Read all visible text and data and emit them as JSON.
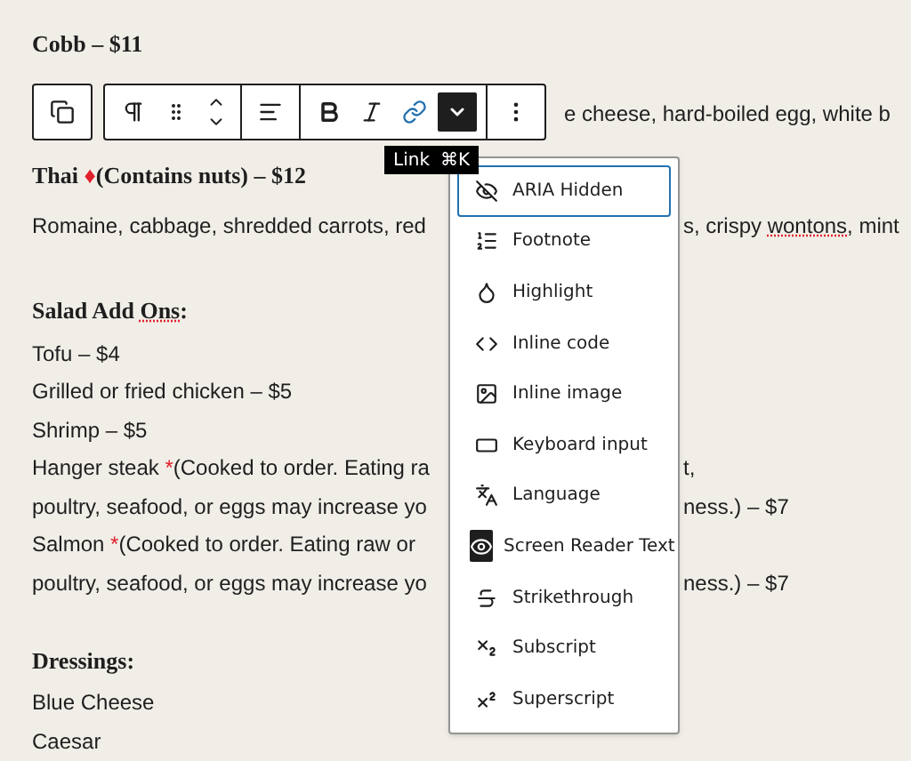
{
  "content": [
    {
      "kind": "heading",
      "left": [
        {
          "kind": "plain",
          "text": "Cobb – $11"
        }
      ]
    },
    {
      "kind": "toolbar_line",
      "right": [
        {
          "kind": "plain",
          "text": "e cheese, hard-boiled egg, white b"
        }
      ]
    },
    {
      "kind": "heading",
      "left": [
        {
          "kind": "plain",
          "text": "Thai "
        },
        {
          "kind": "mark",
          "text": "♦"
        },
        {
          "kind": "plain",
          "text": "(Contains nuts) – $12"
        }
      ]
    },
    {
      "kind": "line",
      "left": [
        {
          "kind": "plain",
          "text": "Romaine, cabbage, shredded carrots, red"
        }
      ],
      "right": [
        {
          "kind": "plain",
          "text": "s, crispy "
        },
        {
          "kind": "flagged",
          "text": "wontons"
        },
        {
          "kind": "plain",
          "text": ", mint"
        }
      ]
    },
    {
      "kind": "heading",
      "left": [
        {
          "kind": "plain",
          "text": "Salad Add "
        },
        {
          "kind": "flagged",
          "text": "Ons"
        },
        {
          "kind": "plain",
          "text": ":"
        }
      ]
    },
    {
      "kind": "item",
      "left": [
        {
          "kind": "plain",
          "text": "Tofu – $4"
        }
      ]
    },
    {
      "kind": "item",
      "left": [
        {
          "kind": "plain",
          "text": "Grilled or fried chicken – $5"
        }
      ]
    },
    {
      "kind": "item",
      "left": [
        {
          "kind": "plain",
          "text": "Shrimp – $5"
        }
      ]
    },
    {
      "kind": "item",
      "left": [
        {
          "kind": "plain",
          "text": "Hanger steak "
        },
        {
          "kind": "mark",
          "text": "*"
        },
        {
          "kind": "plain",
          "text": "(Cooked to order. Eating ra"
        }
      ],
      "right": [
        {
          "kind": "plain",
          "text": "t,"
        }
      ]
    },
    {
      "kind": "item",
      "left": [
        {
          "kind": "plain",
          "text": "poultry, seafood, or eggs may increase yo"
        }
      ],
      "right": [
        {
          "kind": "plain",
          "text": "ness.) – $7"
        }
      ]
    },
    {
      "kind": "item",
      "left": [
        {
          "kind": "plain",
          "text": "Salmon "
        },
        {
          "kind": "mark",
          "text": "*"
        },
        {
          "kind": "plain",
          "text": "(Cooked to order. Eating raw or"
        }
      ]
    },
    {
      "kind": "item",
      "left": [
        {
          "kind": "plain",
          "text": "poultry, seafood, or eggs may increase yo"
        }
      ],
      "right": [
        {
          "kind": "plain",
          "text": "ness.) – $7"
        }
      ]
    },
    {
      "kind": "heading",
      "left": [
        {
          "kind": "plain",
          "text": "Dressings:"
        }
      ]
    },
    {
      "kind": "item",
      "left": [
        {
          "kind": "plain",
          "text": "Blue Cheese"
        }
      ]
    },
    {
      "kind": "item",
      "left": [
        {
          "kind": "plain",
          "text": "Caesar"
        }
      ]
    }
  ],
  "toolbar": {
    "groups": [
      [
        {
          "kind": "paragraph"
        },
        {
          "kind": "drag"
        },
        {
          "kind": "move"
        }
      ],
      [
        {
          "kind": "align"
        }
      ],
      [
        {
          "kind": "bold"
        },
        {
          "kind": "italic"
        },
        {
          "kind": "link"
        },
        {
          "kind": "more_formats"
        }
      ],
      [
        {
          "kind": "options"
        }
      ]
    ],
    "tooltip": {
      "label": "Link",
      "shortcut": "⌘K"
    }
  },
  "format_menu": [
    {
      "kind": "aria_hidden",
      "label": "ARIA Hidden",
      "selected": true,
      "active": false
    },
    {
      "kind": "footnote",
      "label": "Footnote",
      "selected": false,
      "active": false
    },
    {
      "kind": "highlight",
      "label": "Highlight",
      "selected": false,
      "active": false
    },
    {
      "kind": "code",
      "label": "Inline code",
      "selected": false,
      "active": false
    },
    {
      "kind": "image",
      "label": "Inline image",
      "selected": false,
      "active": false
    },
    {
      "kind": "keyboard",
      "label": "Keyboard input",
      "selected": false,
      "active": false
    },
    {
      "kind": "language",
      "label": "Language",
      "selected": false,
      "active": false
    },
    {
      "kind": "screen_reader",
      "label": "Screen Reader Text",
      "selected": false,
      "active": true
    },
    {
      "kind": "strikethrough",
      "label": "Strikethrough",
      "selected": false,
      "active": false
    },
    {
      "kind": "subscript",
      "label": "Subscript",
      "selected": false,
      "active": false
    },
    {
      "kind": "superscript",
      "label": "Superscript",
      "selected": false,
      "active": false
    }
  ]
}
